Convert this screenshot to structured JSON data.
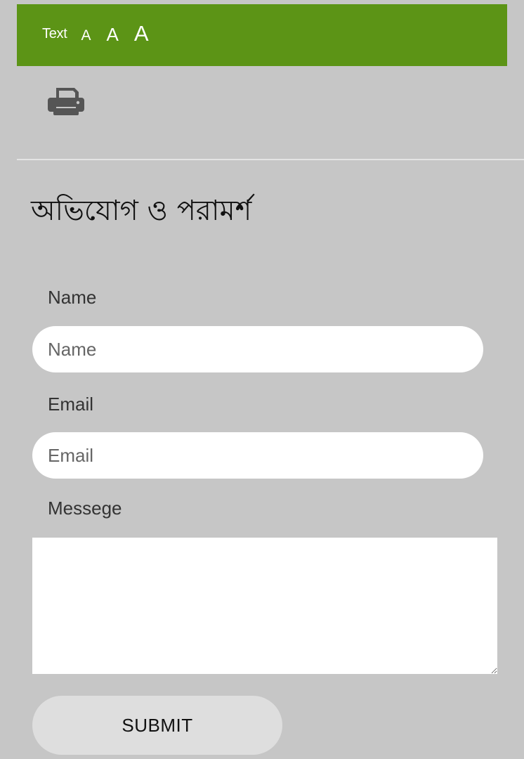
{
  "text_size_bar": {
    "label": "Text",
    "small": "A",
    "medium": "A",
    "large": "A",
    "background_color": "#5c9416"
  },
  "toolbar": {
    "print_icon": "printer-icon"
  },
  "form": {
    "title": "অভিযোগ ও পরামর্শ",
    "name_label": "Name",
    "name_placeholder": "Name",
    "email_label": "Email",
    "email_placeholder": "Email",
    "message_label": "Messege",
    "message_value": "",
    "submit_label": "SUBMIT"
  }
}
